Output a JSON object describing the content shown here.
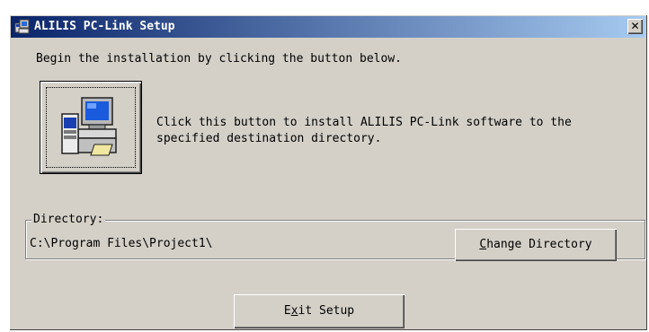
{
  "window": {
    "title": "ALILIS PC-Link Setup",
    "close_label": "✕"
  },
  "instruction": "Begin the installation by clicking the button below.",
  "install": {
    "description_line1": "Click this button to install ALILIS PC-Link software to the",
    "description_line2": "specified destination directory."
  },
  "directory": {
    "legend": "Directory:",
    "path": "C:\\Program Files\\Project1\\",
    "change_button": {
      "mnemonic": "C",
      "rest": "hange Directory"
    }
  },
  "exit_button": {
    "before": "E",
    "mnemonic": "x",
    "rest": "it Setup"
  },
  "colors": {
    "titlebar_start": "#0a246a",
    "titlebar_end": "#a6caf0",
    "face": "#d4d0c8"
  }
}
